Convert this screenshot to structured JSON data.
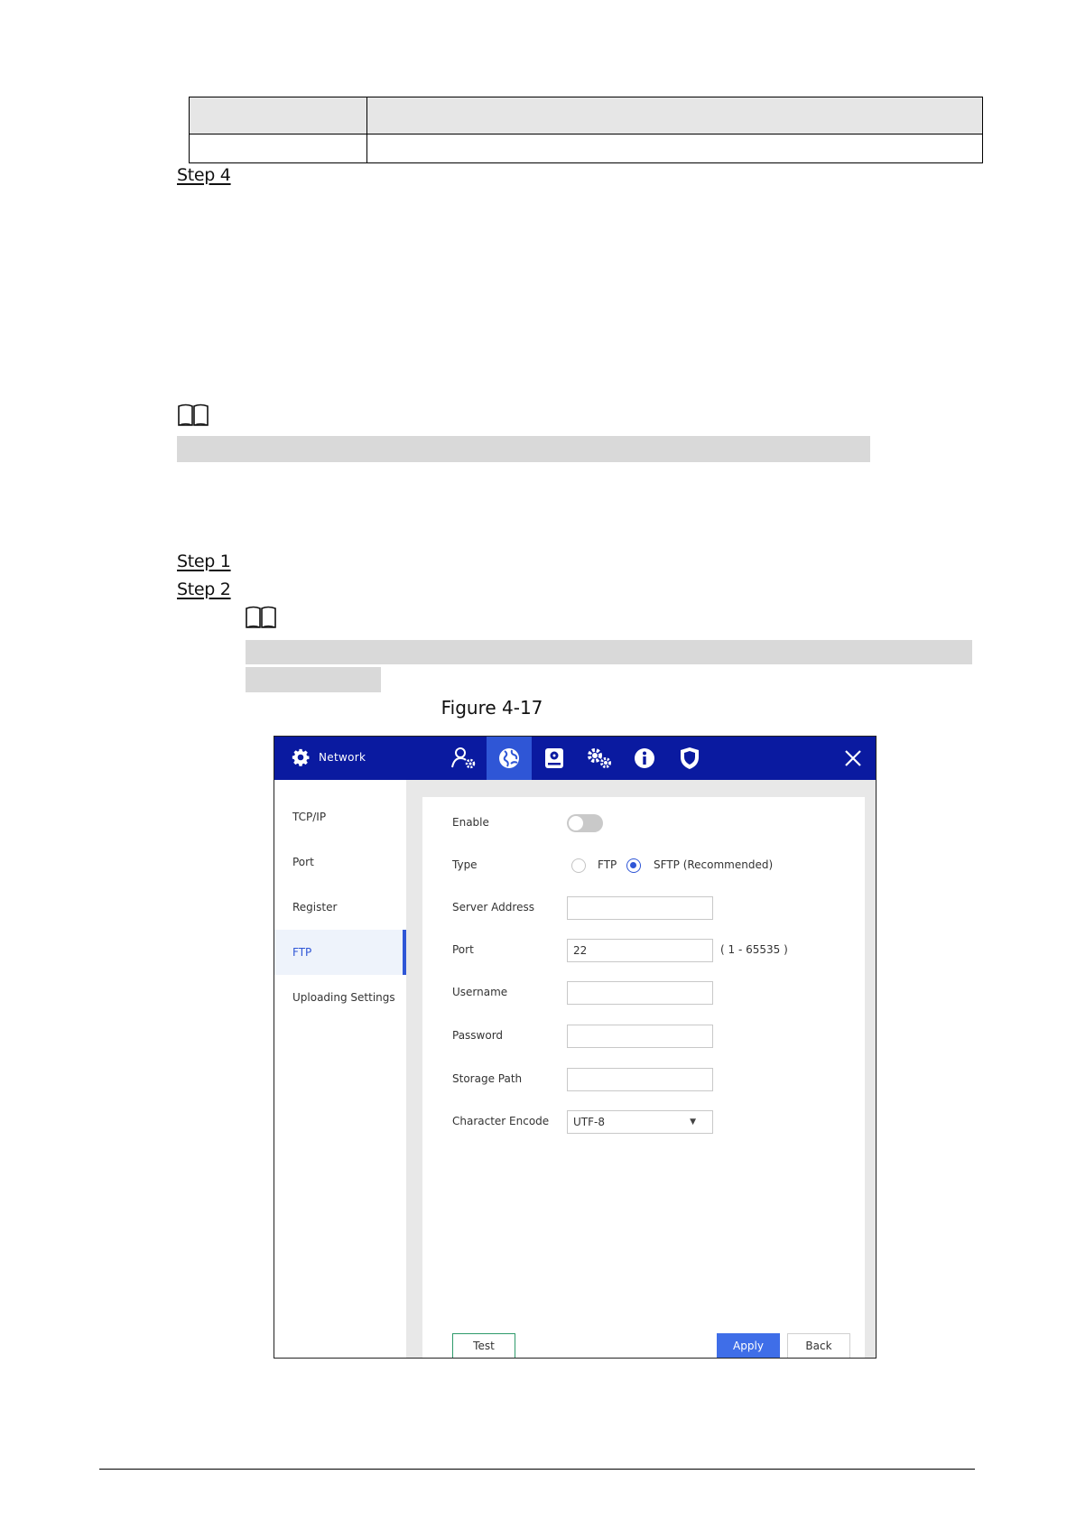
{
  "doc": {
    "steps": [
      "Step 4",
      "Step 1",
      "Step 2"
    ],
    "figure_caption": "Figure 4-17"
  },
  "ui": {
    "header": {
      "title": "Network",
      "tabs": [
        {
          "icon": "user-settings-icon",
          "active": false
        },
        {
          "icon": "network-globe-icon",
          "active": true
        },
        {
          "icon": "storage-icon",
          "active": false
        },
        {
          "icon": "system-settings-icon",
          "active": false
        },
        {
          "icon": "info-icon",
          "active": false
        },
        {
          "icon": "security-shield-icon",
          "active": false
        }
      ]
    },
    "sidebar": {
      "items": [
        {
          "label": "TCP/IP",
          "active": false
        },
        {
          "label": "Port",
          "active": false
        },
        {
          "label": "Register",
          "active": false
        },
        {
          "label": "FTP",
          "active": true
        },
        {
          "label": "Uploading Settings",
          "active": false
        }
      ]
    },
    "form": {
      "enable_label": "Enable",
      "enable_on": false,
      "type_label": "Type",
      "type_options": [
        "FTP",
        "SFTP (Recommended)"
      ],
      "type_selected": "SFTP (Recommended)",
      "server_address_label": "Server Address",
      "server_address_value": "",
      "port_label": "Port",
      "port_value": "22",
      "port_range": "( 1 - 65535 )",
      "username_label": "Username",
      "username_value": "",
      "password_label": "Password",
      "password_value": "",
      "storage_path_label": "Storage Path",
      "storage_path_value": "",
      "char_encode_label": "Character Encode",
      "char_encode_value": "UTF-8"
    },
    "buttons": {
      "test": "Test",
      "apply": "Apply",
      "back": "Back"
    },
    "colors": {
      "header_bg": "#0a1aa0",
      "accent": "#2f56d6",
      "apply_bg": "#3f6ee8"
    }
  }
}
